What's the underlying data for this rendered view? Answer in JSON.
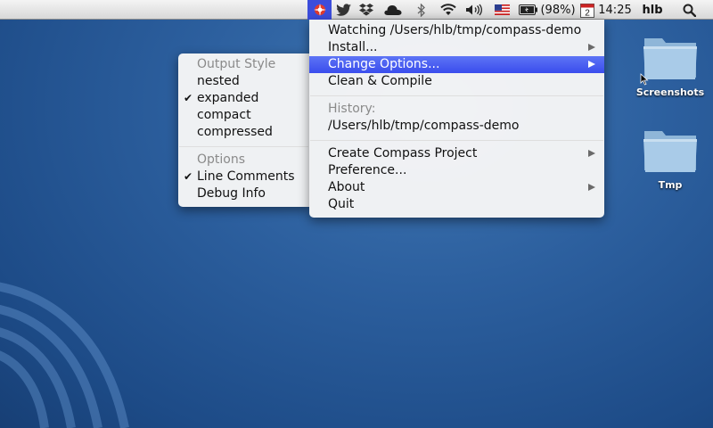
{
  "menubar": {
    "compass_icon": "compass-app-icon",
    "status_icons": [
      "twitter-icon",
      "dropbox-icon",
      "cloud-icon",
      "bluetooth-icon",
      "wifi-icon",
      "volume-icon",
      "flag-icon",
      "battery-icon"
    ],
    "battery": "(98%)",
    "calendar_day": "2",
    "time": "14:25",
    "user": "hlb"
  },
  "main_menu": {
    "watching": "Watching /Users/hlb/tmp/compass-demo",
    "install": "Install...",
    "change_options": "Change Options...",
    "clean_compile": "Clean & Compile",
    "history_header": "History:",
    "history_item": "/Users/hlb/tmp/compass-demo",
    "create_project": "Create Compass Project",
    "preference": "Preference...",
    "about": "About",
    "quit": "Quit"
  },
  "sub_menu": {
    "output_style_header": "Output Style",
    "nested": "nested",
    "expanded": "expanded",
    "compact": "compact",
    "compressed": "compressed",
    "options_header": "Options",
    "line_comments": "Line Comments",
    "debug_info": "Debug Info",
    "checkmark": "✔"
  },
  "desktop": {
    "screenshots_label": "Screenshots",
    "tmp_label": "Tmp"
  },
  "colors": {
    "highlight": "#3a4ded",
    "desktop": "#2c5f9e"
  }
}
